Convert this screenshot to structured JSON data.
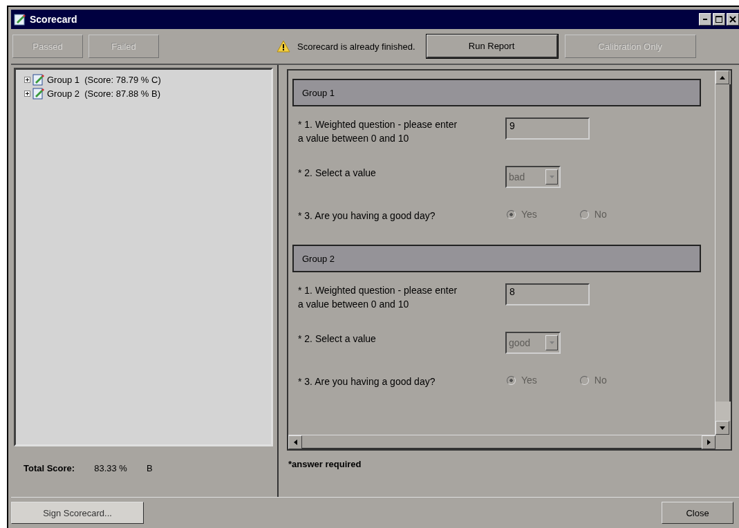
{
  "window": {
    "title": "Scorecard"
  },
  "toolbar": {
    "left_buttons": [
      {
        "label": "Passed",
        "disabled": true
      },
      {
        "label": "Failed",
        "disabled": true
      }
    ],
    "notice": "Scorecard is already finished.",
    "right_buttons": [
      {
        "label": "Run Report",
        "disabled": false
      },
      {
        "label": "Calibration Only",
        "disabled": true
      }
    ]
  },
  "tree": {
    "items": [
      {
        "label": "Group 1",
        "score": "(Score: 78.79 % C)",
        "expanded": false
      },
      {
        "label": "Group 2",
        "score": "(Score: 87.88 % B)",
        "expanded": false
      }
    ]
  },
  "total": {
    "label": "Total Score:",
    "value": "83.33 %",
    "grade": "B"
  },
  "groups": [
    {
      "title": "Group 1",
      "questions": [
        {
          "kind": "text",
          "label": "* 1.  Weighted question - please enter a value between 0 and 10",
          "value": "9"
        },
        {
          "kind": "select",
          "label": "* 2.  Select a value",
          "value": "bad",
          "disabled": true
        },
        {
          "kind": "radio",
          "label": "* 3.  Are you having a good day?",
          "options": [
            {
              "label": "Yes",
              "selected": true
            },
            {
              "label": "No",
              "selected": false
            }
          ]
        }
      ]
    },
    {
      "title": "Group 2",
      "questions": [
        {
          "kind": "text",
          "label": "* 1.  Weighted question - please enter a value between 0 and 10",
          "value": "8"
        },
        {
          "kind": "select",
          "label": "* 2.  Select a value",
          "value": "good",
          "disabled": true
        },
        {
          "kind": "radio",
          "label": "* 3.  Are you having a good day?",
          "options": [
            {
              "label": "Yes",
              "selected": true
            },
            {
              "label": "No",
              "selected": false
            }
          ]
        }
      ]
    }
  ],
  "footnote": "*answer required",
  "footer": {
    "sign_button": "Sign Scorecard...",
    "close_button": "Close"
  }
}
